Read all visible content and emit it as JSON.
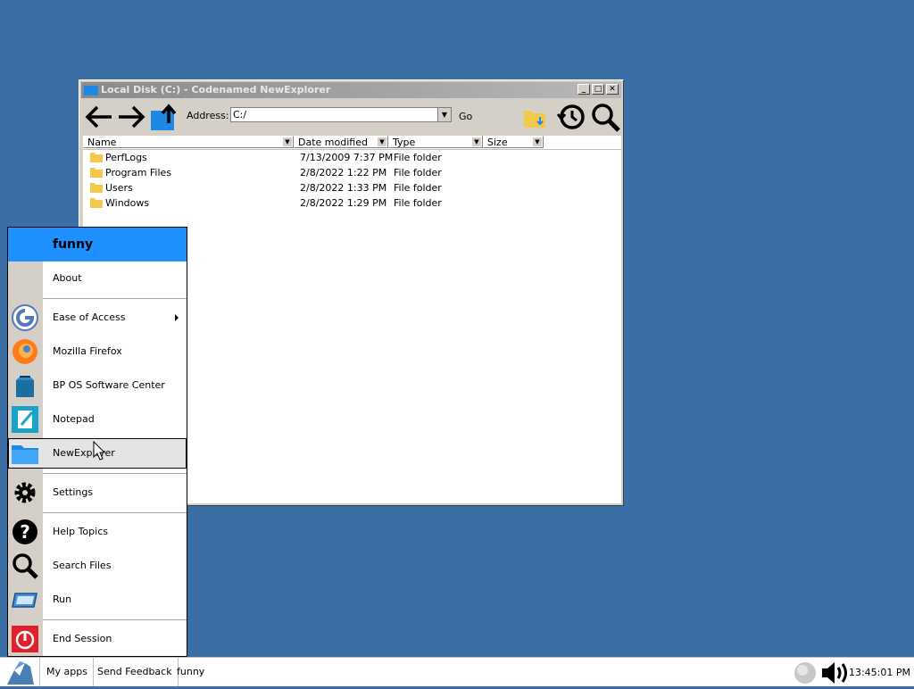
{
  "window": {
    "title": "Local Disk (C:) - Codenamed NewExplorer",
    "minimize": "_",
    "maximize": "□",
    "close": "✕",
    "address_label": "Address:",
    "address_value": "C:/",
    "go_label": "Go",
    "columns": [
      "Name",
      "Date modified",
      "Type",
      "Size"
    ],
    "files": [
      {
        "name": "PerfLogs",
        "date": "7/13/2009 7:37 PM",
        "type": "File folder"
      },
      {
        "name": "Program Files",
        "date": "2/8/2022 1:22 PM",
        "type": "File folder"
      },
      {
        "name": "Users",
        "date": "2/8/2022 1:33 PM",
        "type": "File folder"
      },
      {
        "name": "Windows",
        "date": "2/8/2022 1:29 PM",
        "type": "File folder"
      }
    ]
  },
  "startmenu": {
    "user": "funny",
    "items": {
      "about": "About",
      "ease": "Ease of Access",
      "firefox": "Mozilla Firefox",
      "software": "BP OS Software Center",
      "notepad": "Notepad",
      "newexplorer": "NewExplorer",
      "settings": "Settings",
      "help": "Help Topics",
      "search": "Search Files",
      "run": "Run",
      "end": "End Session"
    }
  },
  "taskbar": {
    "myapps": "My apps",
    "feedback": "Send Feedback",
    "user": "funny",
    "clock": "13:45:01 PM"
  },
  "colors": {
    "desktop": "#3b6ea5",
    "accent": "#1e90ff",
    "folder": "#f2c94c"
  }
}
